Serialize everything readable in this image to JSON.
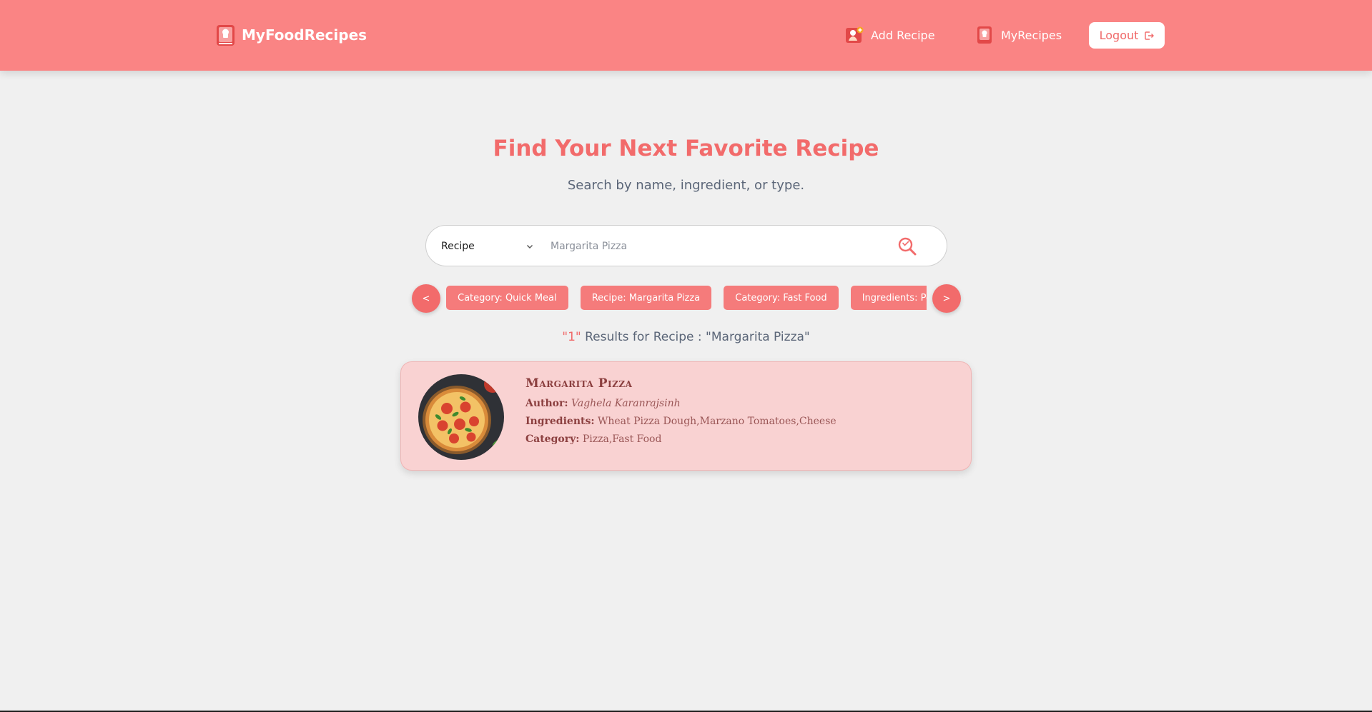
{
  "header": {
    "brand": "MyFoodRecipes",
    "nav": {
      "add_recipe": "Add Recipe",
      "my_recipes": "MyRecipes"
    },
    "logout": "Logout"
  },
  "hero": {
    "title": "Find Your Next Favorite Recipe",
    "subtitle": "Search by name, ingredient, or type."
  },
  "search": {
    "type": "Recipe",
    "query": "Margarita Pizza"
  },
  "chips": {
    "prev": "<",
    "next": ">",
    "items": [
      {
        "label": "Category: Quick Meal"
      },
      {
        "label": "Recipe: Margarita Pizza"
      },
      {
        "label": "Category: Fast Food"
      },
      {
        "label": "Ingredients: Potato"
      }
    ]
  },
  "results": {
    "count": "\"1\"",
    "text": " Results for Recipe : \"Margarita Pizza\""
  },
  "recipe": {
    "title": "Margarita Pizza",
    "author_label": "Author:",
    "author": "Vaghela Karanrajsinh",
    "ingredients_label": "Ingredients:",
    "ingredients": "Wheat Pizza Dough,Marzano Tomatoes,Cheese",
    "category_label": "Category:",
    "category": "Pizza,Fast Food"
  },
  "colors": {
    "header_bg": "#fa8484",
    "accent": "#f26b6b",
    "card_bg": "#f9d2d2",
    "page_bg": "#f0f0f0"
  },
  "icons": {
    "brand": "recipe-book-icon",
    "add_recipe": "chef-add-icon",
    "my_recipes": "recipe-book-icon",
    "logout": "logout-arrow-icon",
    "search": "search-magnifier-icon",
    "select": "chevron-down-icon"
  }
}
